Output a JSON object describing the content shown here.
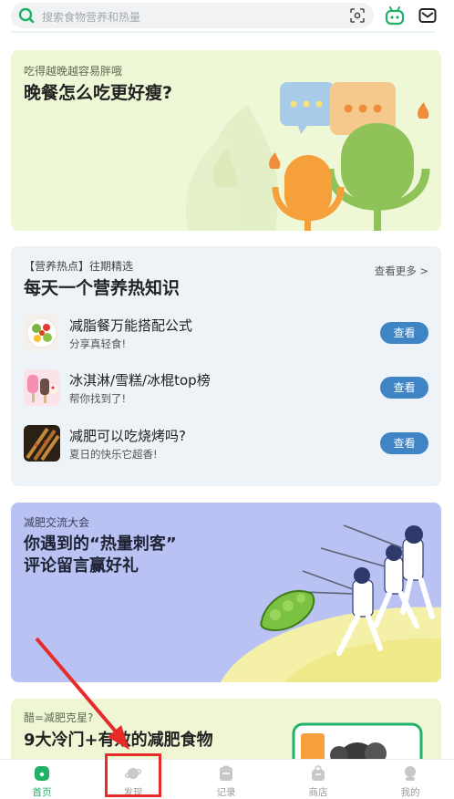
{
  "search": {
    "placeholder": "搜索食物营养和热量"
  },
  "card1": {
    "subtitle": "吃得越晚越容易胖哦",
    "title": "晚餐怎么吃更好瘦?"
  },
  "card2": {
    "subtitle": "【营养热点】往期精选",
    "more": "查看更多 >",
    "title": "每天一个营养热知识",
    "items": [
      {
        "title": "减脂餐万能搭配公式",
        "subtitle": "分享真轻食!",
        "button": "查看"
      },
      {
        "title": "冰淇淋/雪糕/冰棍top榜",
        "subtitle": "帮你找到了!",
        "button": "查看"
      },
      {
        "title": "减肥可以吃烧烤吗?",
        "subtitle": "夏日的快乐它超香!",
        "button": "查看"
      }
    ]
  },
  "card3": {
    "subtitle": "减肥交流大会",
    "title_line1": "你遇到的“热量刺客”",
    "title_line2": "评论留言赢好礼"
  },
  "card4": {
    "subtitle": "醋=减肥克星?",
    "title": "9大冷门+有效的减肥食物"
  },
  "nav": {
    "tabs": [
      {
        "label": "首页",
        "icon": "home-icon",
        "active": true
      },
      {
        "label": "发现",
        "icon": "discover-planet-icon",
        "active": false
      },
      {
        "label": "记录",
        "icon": "record-icon",
        "active": false
      },
      {
        "label": "商店",
        "icon": "store-bag-icon",
        "active": false
      },
      {
        "label": "我的",
        "icon": "profile-icon",
        "active": false
      }
    ]
  },
  "colors": {
    "accent": "#22b169",
    "button": "#3f85c6",
    "highlight": "#e72b2b"
  }
}
